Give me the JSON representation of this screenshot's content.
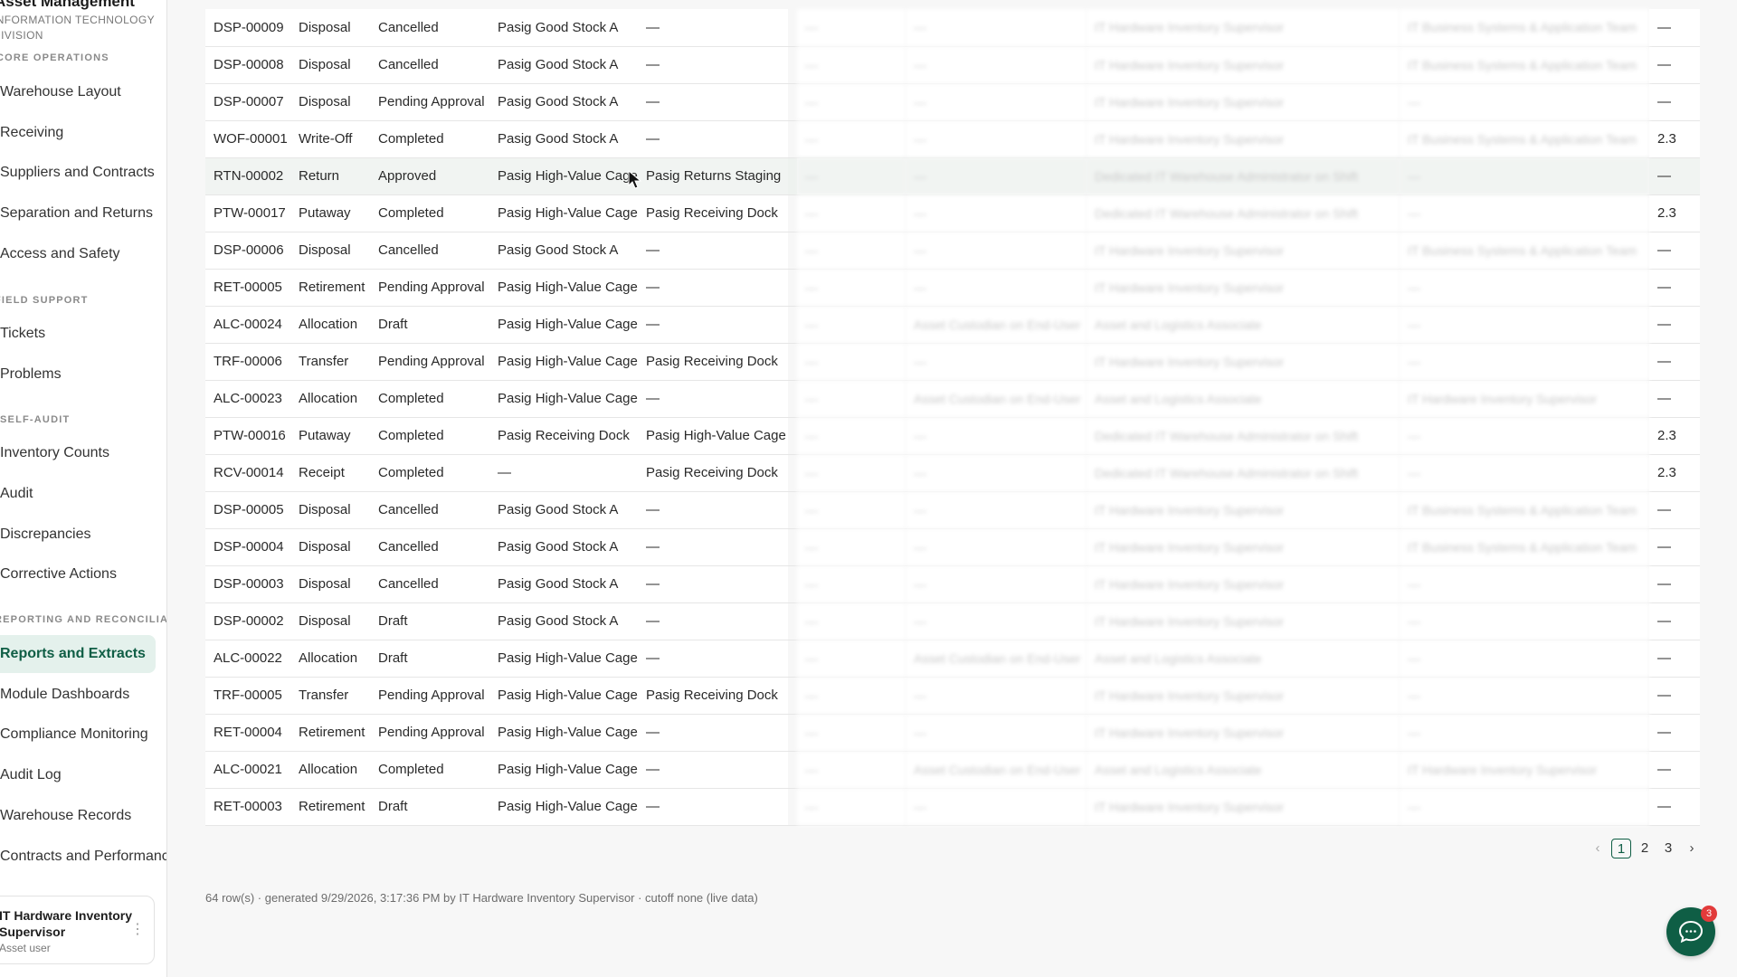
{
  "sidebar": {
    "brand_title": "Asset Management",
    "brand_sub_1": "INFORMATION TECHNOLOGY",
    "brand_sub_2": "DIVISION",
    "sections": [
      {
        "label": "CORE OPERATIONS"
      },
      {
        "label": "FIELD SUPPORT"
      },
      {
        "label": "SELF-AUDIT"
      },
      {
        "label": "REPORTING AND RECONCILIATION"
      }
    ],
    "items": [
      {
        "label": "Warehouse Layout"
      },
      {
        "label": "Receiving"
      },
      {
        "label": "Suppliers and Contracts"
      },
      {
        "label": "Separation and Returns"
      },
      {
        "label": "Access and Safety"
      },
      {
        "label": "Tickets"
      },
      {
        "label": "Problems"
      },
      {
        "label": "Inventory Counts"
      },
      {
        "label": "Audit"
      },
      {
        "label": "Discrepancies"
      },
      {
        "label": "Corrective Actions"
      },
      {
        "label": "Reports and Extracts"
      },
      {
        "label": "Module Dashboards"
      },
      {
        "label": "Compliance Monitoring"
      },
      {
        "label": "Audit Log"
      },
      {
        "label": "Warehouse Records"
      },
      {
        "label": "Contracts and Performance"
      }
    ],
    "user": {
      "name_1": "IT Hardware Inventory",
      "name_2": "Supervisor",
      "role": "Asset user"
    }
  },
  "table": {
    "rows": [
      {
        "id": "DSP-00009",
        "type": "Disposal",
        "status": "Cancelled",
        "from": "Pasig Good Stock A",
        "to": "—",
        "c1": "—",
        "c2": "—",
        "c3": "IT Hardware Inventory Supervisor",
        "c4": "IT Business Systems & Application Team",
        "val": "—"
      },
      {
        "id": "DSP-00008",
        "type": "Disposal",
        "status": "Cancelled",
        "from": "Pasig Good Stock A",
        "to": "—",
        "c1": "—",
        "c2": "—",
        "c3": "IT Hardware Inventory Supervisor",
        "c4": "IT Business Systems & Application Team",
        "val": "—"
      },
      {
        "id": "DSP-00007",
        "type": "Disposal",
        "status": "Pending Approval",
        "from": "Pasig Good Stock A",
        "to": "—",
        "c1": "—",
        "c2": "—",
        "c3": "IT Hardware Inventory Supervisor",
        "c4": "—",
        "val": "—"
      },
      {
        "id": "WOF-00001",
        "type": "Write-Off",
        "status": "Completed",
        "from": "Pasig Good Stock A",
        "to": "—",
        "c1": "—",
        "c2": "—",
        "c3": "IT Hardware Inventory Supervisor",
        "c4": "IT Business Systems & Application Team",
        "val": "2.3"
      },
      {
        "id": "RTN-00002",
        "type": "Return",
        "status": "Approved",
        "from": "Pasig High-Value Cage",
        "to": "Pasig Returns Staging",
        "c1": "—",
        "c2": "—",
        "c3": "Dedicated IT Warehouse Administrator on Shift",
        "c4": "—",
        "val": "—"
      },
      {
        "id": "PTW-00017",
        "type": "Putaway",
        "status": "Completed",
        "from": "Pasig High-Value Cage",
        "to": "Pasig Receiving Dock",
        "c1": "—",
        "c2": "—",
        "c3": "Dedicated IT Warehouse Administrator on Shift",
        "c4": "—",
        "val": "2.3"
      },
      {
        "id": "DSP-00006",
        "type": "Disposal",
        "status": "Cancelled",
        "from": "Pasig Good Stock A",
        "to": "—",
        "c1": "—",
        "c2": "—",
        "c3": "IT Hardware Inventory Supervisor",
        "c4": "IT Business Systems & Application Team",
        "val": "—"
      },
      {
        "id": "RET-00005",
        "type": "Retirement",
        "status": "Pending Approval",
        "from": "Pasig High-Value Cage",
        "to": "—",
        "c1": "—",
        "c2": "—",
        "c3": "IT Hardware Inventory Supervisor",
        "c4": "—",
        "val": "—"
      },
      {
        "id": "ALC-00024",
        "type": "Allocation",
        "status": "Draft",
        "from": "Pasig High-Value Cage",
        "to": "—",
        "c1": "—",
        "c2": "Asset Custodian on End-User",
        "c3": "Asset and Logistics Associate",
        "c4": "—",
        "val": "—"
      },
      {
        "id": "TRF-00006",
        "type": "Transfer",
        "status": "Pending Approval",
        "from": "Pasig High-Value Cage",
        "to": "Pasig Receiving Dock",
        "c1": "—",
        "c2": "—",
        "c3": "IT Hardware Inventory Supervisor",
        "c4": "—",
        "val": "—"
      },
      {
        "id": "ALC-00023",
        "type": "Allocation",
        "status": "Completed",
        "from": "Pasig High-Value Cage",
        "to": "—",
        "c1": "—",
        "c2": "Asset Custodian on End-User",
        "c3": "Asset and Logistics Associate",
        "c4": "IT Hardware Inventory Supervisor",
        "val": "—"
      },
      {
        "id": "PTW-00016",
        "type": "Putaway",
        "status": "Completed",
        "from": "Pasig Receiving Dock",
        "to": "Pasig High-Value Cage",
        "c1": "—",
        "c2": "—",
        "c3": "Dedicated IT Warehouse Administrator on Shift",
        "c4": "—",
        "val": "2.3"
      },
      {
        "id": "RCV-00014",
        "type": "Receipt",
        "status": "Completed",
        "from": "—",
        "to": "Pasig Receiving Dock",
        "c1": "—",
        "c2": "—",
        "c3": "Dedicated IT Warehouse Administrator on Shift",
        "c4": "—",
        "val": "2.3"
      },
      {
        "id": "DSP-00005",
        "type": "Disposal",
        "status": "Cancelled",
        "from": "Pasig Good Stock A",
        "to": "—",
        "c1": "—",
        "c2": "—",
        "c3": "IT Hardware Inventory Supervisor",
        "c4": "IT Business Systems & Application Team",
        "val": "—"
      },
      {
        "id": "DSP-00004",
        "type": "Disposal",
        "status": "Cancelled",
        "from": "Pasig Good Stock A",
        "to": "—",
        "c1": "—",
        "c2": "—",
        "c3": "IT Hardware Inventory Supervisor",
        "c4": "IT Business Systems & Application Team",
        "val": "—"
      },
      {
        "id": "DSP-00003",
        "type": "Disposal",
        "status": "Cancelled",
        "from": "Pasig Good Stock A",
        "to": "—",
        "c1": "—",
        "c2": "—",
        "c3": "IT Hardware Inventory Supervisor",
        "c4": "—",
        "val": "—"
      },
      {
        "id": "DSP-00002",
        "type": "Disposal",
        "status": "Draft",
        "from": "Pasig Good Stock A",
        "to": "—",
        "c1": "—",
        "c2": "—",
        "c3": "IT Hardware Inventory Supervisor",
        "c4": "—",
        "val": "—"
      },
      {
        "id": "ALC-00022",
        "type": "Allocation",
        "status": "Draft",
        "from": "Pasig High-Value Cage",
        "to": "—",
        "c1": "—",
        "c2": "Asset Custodian on End-User",
        "c3": "Asset and Logistics Associate",
        "c4": "—",
        "val": "—"
      },
      {
        "id": "TRF-00005",
        "type": "Transfer",
        "status": "Pending Approval",
        "from": "Pasig High-Value Cage",
        "to": "Pasig Receiving Dock",
        "c1": "—",
        "c2": "—",
        "c3": "IT Hardware Inventory Supervisor",
        "c4": "—",
        "val": "—"
      },
      {
        "id": "RET-00004",
        "type": "Retirement",
        "status": "Pending Approval",
        "from": "Pasig High-Value Cage",
        "to": "—",
        "c1": "—",
        "c2": "—",
        "c3": "IT Hardware Inventory Supervisor",
        "c4": "—",
        "val": "—"
      },
      {
        "id": "ALC-00021",
        "type": "Allocation",
        "status": "Completed",
        "from": "Pasig High-Value Cage",
        "to": "—",
        "c1": "—",
        "c2": "Asset Custodian on End-User",
        "c3": "Asset and Logistics Associate",
        "c4": "IT Hardware Inventory Supervisor",
        "val": "—"
      },
      {
        "id": "RET-00003",
        "type": "Retirement",
        "status": "Draft",
        "from": "Pasig High-Value Cage",
        "to": "—",
        "c1": "—",
        "c2": "—",
        "c3": "IT Hardware Inventory Supervisor",
        "c4": "—",
        "val": "—"
      }
    ]
  },
  "pagination": {
    "prev": "‹",
    "pages": [
      "1",
      "2",
      "3"
    ],
    "next": "›"
  },
  "footer": {
    "meta": "64 row(s) · generated 9/29/2026, 3:17:36 PM by IT Hardware Inventory Supervisor · cutoff none (live data)"
  },
  "chat": {
    "badge": "3",
    "icon": "chat-icon"
  },
  "colors": {
    "accent": "#0f5e45",
    "active_bg": "#e4f1ec",
    "badge": "#e23b3b"
  }
}
